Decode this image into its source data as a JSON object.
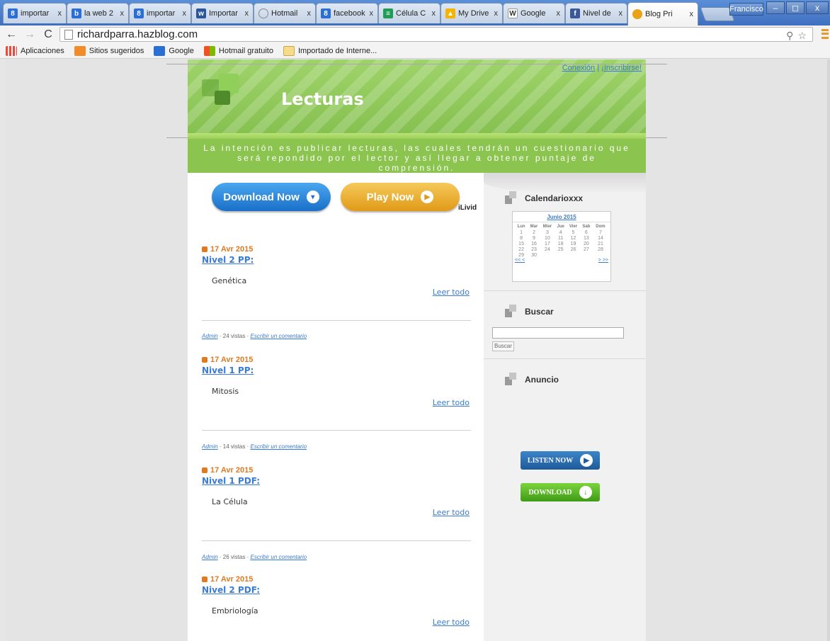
{
  "browser": {
    "tabs": [
      {
        "label": "importar",
        "icon": "google-icon",
        "color": "#2a6fd6"
      },
      {
        "label": "la web 2",
        "icon": "blogger-icon",
        "color": "#2a6fd6"
      },
      {
        "label": "importar",
        "icon": "google-icon",
        "color": "#2a6fd6"
      },
      {
        "label": "Importar",
        "icon": "word-icon",
        "color": "#2a5699"
      },
      {
        "label": "Hotmail",
        "icon": "loading-icon",
        "color": "#888888"
      },
      {
        "label": "facebook",
        "icon": "google-icon",
        "color": "#2a6fd6"
      },
      {
        "label": "Célula C",
        "icon": "sheets-icon",
        "color": "#1f9d55"
      },
      {
        "label": "My Drive",
        "icon": "drive-icon",
        "color": "#f4b400"
      },
      {
        "label": "Google",
        "icon": "wikipedia-icon",
        "color": "#555555"
      },
      {
        "label": "Nivel de",
        "icon": "facebook-icon",
        "color": "#3b5998"
      },
      {
        "label": "Blog Pri",
        "icon": "site-icon",
        "color": "#e8a317"
      }
    ],
    "tab_close": "x",
    "profile_name": "Francisco",
    "window_controls": {
      "minimize": "–",
      "maximize": "◻",
      "close": "x"
    },
    "url": "richardparra.hazblog.com",
    "bookmarks": [
      {
        "label": "Aplicaciones",
        "color": "#e84c3d"
      },
      {
        "label": "Sitios sugeridos",
        "color": "#f28c28"
      },
      {
        "label": "Google",
        "color": "#2a6fd6"
      },
      {
        "label": "Hotmail gratuito",
        "color": "#f25022"
      },
      {
        "label": "Importado de Interne...",
        "color": "#e8c25a"
      }
    ]
  },
  "blog": {
    "title": "Lecturas",
    "top_links": {
      "login": "Conexión",
      "separator": "|",
      "signup": "¡Inscribirse!"
    },
    "tagline": "La intención es publicar lecturas, las cuales tendrán un cuestionario que será repondido por el lector y así llegar a obtener puntaje de comprensión.",
    "ad": {
      "download_label": "Download Now",
      "play_label": "Play Now",
      "brand": "iLivid"
    },
    "read_more": "Leer todo",
    "posts": [
      {
        "date": "17 Avr 2015",
        "title": "Nivel 2 PP:",
        "body": "Genética"
      },
      {
        "date": "17 Avr 2015",
        "title": "Nivel 1 PP:",
        "body": "Mitosis"
      },
      {
        "date": "17 Avr 2015",
        "title": "Nivel 1 PDF:",
        "body": "La Célula"
      },
      {
        "date": "17 Avr 2015",
        "title": "Nivel 2 PDF:",
        "body": "Embriología"
      }
    ],
    "metas": [
      {
        "author": "Admin",
        "views": " · 24 vistas · ",
        "comment": "Escribir un comentario"
      },
      {
        "author": "Admin",
        "views": " · 14 vistas · ",
        "comment": "Escribir un comentario"
      },
      {
        "author": "Admin",
        "views": " · 26 vistas · ",
        "comment": "Escribir un comentario"
      }
    ],
    "sidebar": {
      "calendar_title": "Calendarioxxx",
      "calendar": {
        "month": "Junio 2015",
        "days": [
          "Lun",
          "Mar",
          "Mier",
          "Jue",
          "Vier",
          "Sab",
          "Dom"
        ],
        "weeks": [
          [
            "1",
            "2",
            "3",
            "4",
            "5",
            "6",
            "7"
          ],
          [
            "8",
            "9",
            "10",
            "11",
            "12",
            "13",
            "14"
          ],
          [
            "15",
            "16",
            "17",
            "18",
            "19",
            "20",
            "21"
          ],
          [
            "22",
            "23",
            "24",
            "25",
            "26",
            "27",
            "28"
          ],
          [
            "29",
            "30",
            "",
            "",
            "",
            "",
            ""
          ]
        ],
        "prev": "<< <",
        "next": "> >>"
      },
      "search_title": "Buscar",
      "search_button": "Buscar",
      "ad_title": "Anuncio",
      "listen_label": "LISTEN NOW",
      "download_label": "DOWNLOAD"
    }
  }
}
